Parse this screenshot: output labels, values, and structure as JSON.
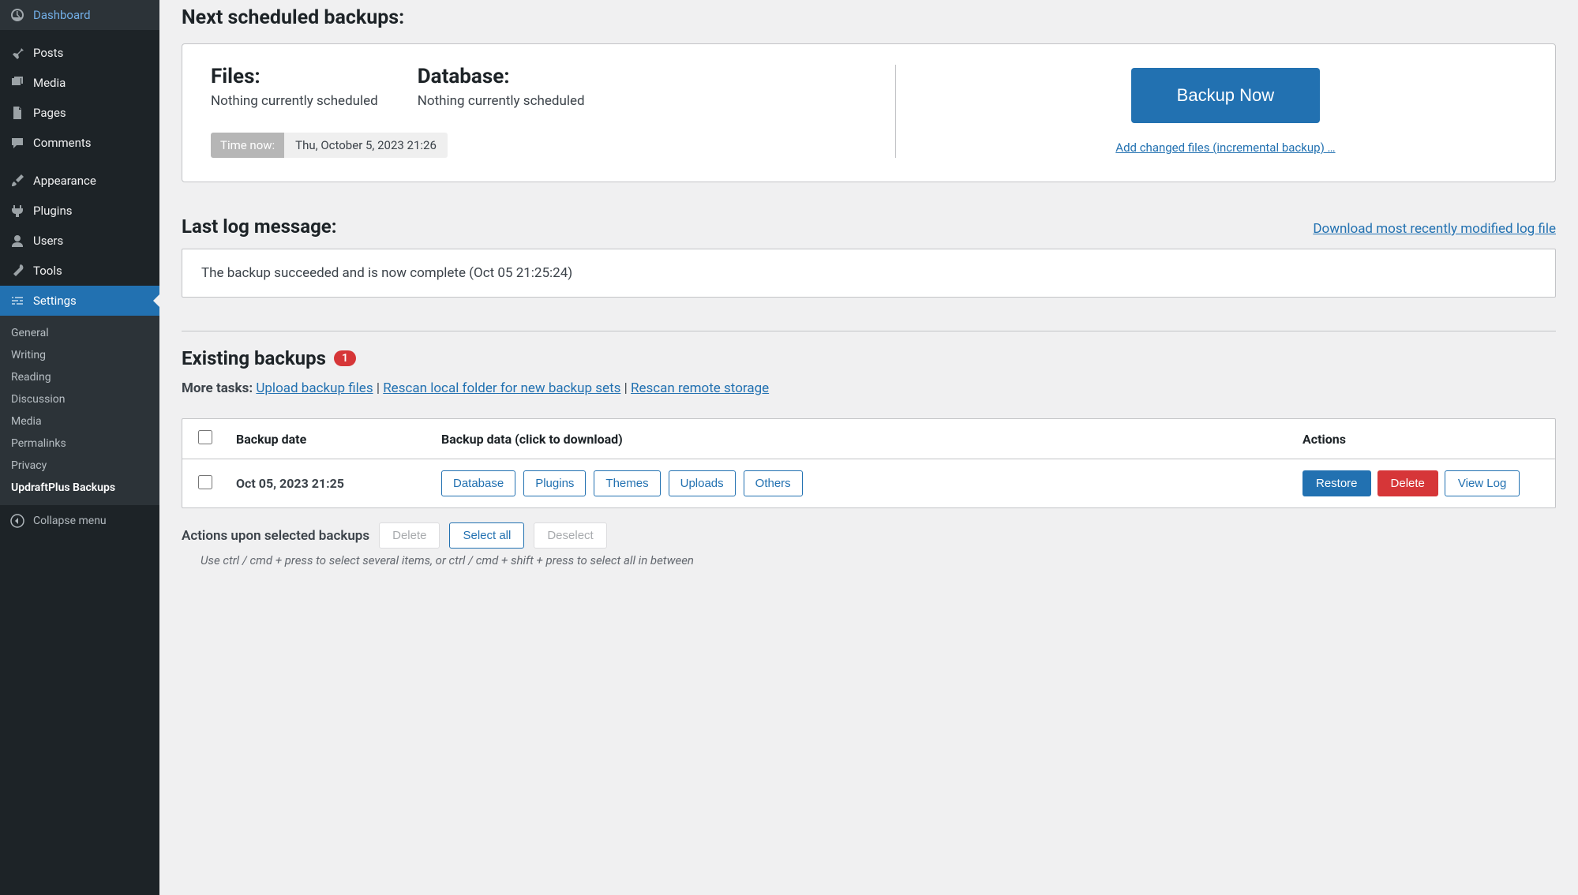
{
  "sidebar": {
    "items": [
      {
        "label": "Dashboard",
        "icon": "dashboard"
      },
      {
        "label": "Posts",
        "icon": "pin"
      },
      {
        "label": "Media",
        "icon": "media"
      },
      {
        "label": "Pages",
        "icon": "page"
      },
      {
        "label": "Comments",
        "icon": "comment"
      },
      {
        "label": "Appearance",
        "icon": "brush"
      },
      {
        "label": "Plugins",
        "icon": "plug"
      },
      {
        "label": "Users",
        "icon": "user"
      },
      {
        "label": "Tools",
        "icon": "wrench"
      },
      {
        "label": "Settings",
        "icon": "slider"
      }
    ],
    "submenu": [
      "General",
      "Writing",
      "Reading",
      "Discussion",
      "Media",
      "Permalinks",
      "Privacy",
      "UpdraftPlus Backups"
    ],
    "collapse": "Collapse menu"
  },
  "scheduled": {
    "heading": "Next scheduled backups:",
    "files_label": "Files:",
    "files_value": "Nothing currently scheduled",
    "db_label": "Database:",
    "db_value": "Nothing currently scheduled",
    "time_now_label": "Time now:",
    "time_now_value": "Thu, October 5, 2023 21:26",
    "backup_now": "Backup Now",
    "incremental_link": "Add changed files (incremental backup) …"
  },
  "last_log": {
    "heading": "Last log message:",
    "download_link": "Download most recently modified log file",
    "message": "The backup succeeded and is now complete (Oct 05 21:25:24)"
  },
  "existing": {
    "heading": "Existing backups",
    "count": "1",
    "more_tasks_label": "More tasks:",
    "upload_link": "Upload backup files",
    "rescan_local": "Rescan local folder for new backup sets",
    "rescan_remote": "Rescan remote storage",
    "table": {
      "col_date": "Backup date",
      "col_data": "Backup data (click to download)",
      "col_actions": "Actions"
    },
    "rows": [
      {
        "date": "Oct 05, 2023 21:25",
        "data": [
          "Database",
          "Plugins",
          "Themes",
          "Uploads",
          "Others"
        ],
        "actions": {
          "restore": "Restore",
          "delete": "Delete",
          "view_log": "View Log"
        }
      }
    ],
    "bulk": {
      "label": "Actions upon selected backups",
      "delete": "Delete",
      "select_all": "Select all",
      "deselect": "Deselect",
      "hint": "Use ctrl / cmd + press to select several items, or ctrl / cmd + shift + press to select all in between"
    }
  }
}
